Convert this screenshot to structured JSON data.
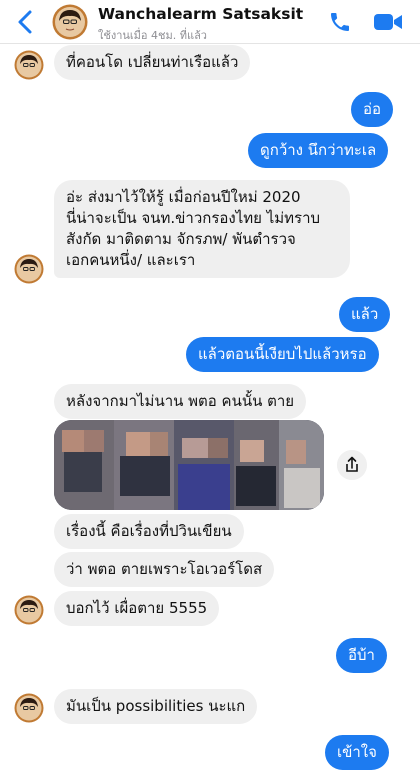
{
  "header": {
    "name": "Wanchalearm Satsaksit",
    "status": "ใช้งานเมื่อ 4ชม. ที่แล้ว"
  },
  "messages": {
    "m1": "ที่คอนโด เปลี่ยนท่าเรือแล้ว",
    "m2": "อ่อ",
    "m3": "ดูกว้าง นึกว่าทะเล",
    "m4_l1": "อ่ะ ส่งมาไว้ให้รู้ เมื่อก่อนปีใหม่ 2020",
    "m4_l2": "นี่น่าจะเป็น จนท.ข่าวกรองไทย ไม่ทราบ",
    "m4_l3": "สังกัด มาติดตาม จักรภพ/ พันตำรวจ",
    "m4_l4": "เอกคนหนึ่ง/ และเรา",
    "m5": "แล้ว",
    "m6": "แล้วตอนนี้เงียบไปแล้วหรอ",
    "m7": "หลังจากมาไม่นาน พตอ คนนั้น ตาย",
    "m8": "เรื่องนี้ คือเรื่องที่ปวินเขียน",
    "m9": "ว่า พตอ ตายเพราะโอเวอร์โดส",
    "m10": "บอกไว้ เผื่อตาย 5555",
    "m11": "อีบ้า",
    "m12": "มันเป็น possibilities นะแก",
    "m13": "เข้าใจ"
  },
  "colors": {
    "accent": "#1d7bf0",
    "incoming_bubble": "#efefef",
    "outgoing_text": "#ffffff"
  },
  "icons": {
    "back": "chevron-left-icon",
    "call": "phone-icon",
    "video": "video-camera-icon",
    "share": "share-icon"
  }
}
